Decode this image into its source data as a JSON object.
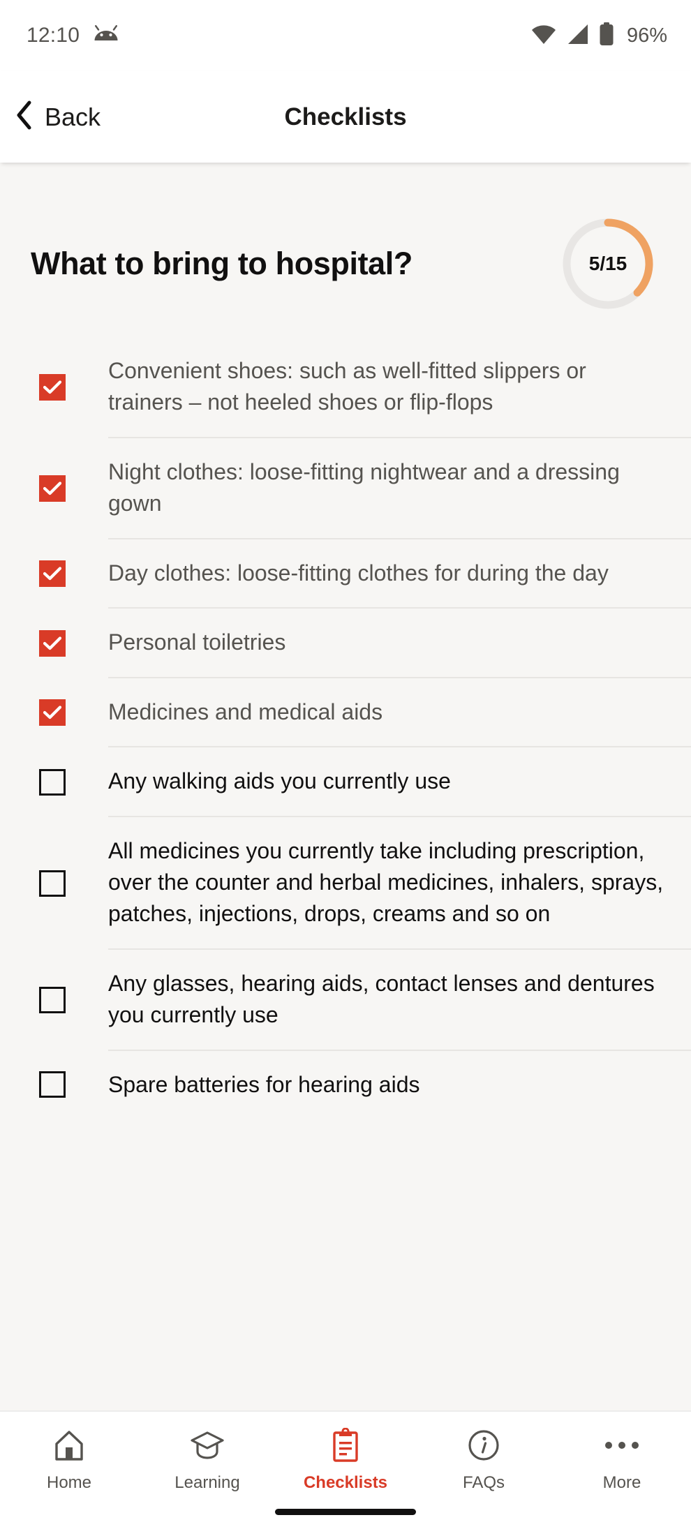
{
  "status_bar": {
    "time": "12:10",
    "battery_percent": "96%",
    "icons": [
      "android-robot-icon",
      "wifi-icon",
      "cellular-signal-icon",
      "battery-icon"
    ]
  },
  "nav_bar": {
    "back_label": "Back",
    "title": "Checklists"
  },
  "page": {
    "title": "What to bring to hospital?",
    "progress": {
      "label": "5/15",
      "completed": 5,
      "total": 15,
      "arc_color": "#efa262",
      "track_color": "#e8e6e4"
    }
  },
  "checklist": {
    "items": [
      {
        "label": "Convenient shoes: such as well-fitted slippers or trainers – not heeled shoes or flip-flops",
        "checked": true
      },
      {
        "label": "Night clothes: loose-fitting nightwear and a dressing gown",
        "checked": true
      },
      {
        "label": "Day clothes: loose-fitting clothes for during the day",
        "checked": true
      },
      {
        "label": "Personal toiletries",
        "checked": true
      },
      {
        "label": "Medicines and medical aids",
        "checked": true
      },
      {
        "label": "Any walking aids you currently use",
        "checked": false
      },
      {
        "label": "All medicines you currently take including prescription, over the counter and herbal medicines, inhalers, sprays, patches, injections, drops, creams and so on",
        "checked": false
      },
      {
        "label": "Any glasses, hearing aids, contact lenses and dentures you currently use",
        "checked": false
      },
      {
        "label": "Spare batteries for hearing aids",
        "checked": false
      }
    ]
  },
  "tab_bar": {
    "tabs": [
      {
        "label": "Home",
        "icon": "home-icon",
        "active": false
      },
      {
        "label": "Learning",
        "icon": "graduation-cap-icon",
        "active": false
      },
      {
        "label": "Checklists",
        "icon": "clipboard-icon",
        "active": true
      },
      {
        "label": "FAQs",
        "icon": "info-circle-icon",
        "active": false
      },
      {
        "label": "More",
        "icon": "ellipsis-icon",
        "active": false
      }
    ]
  },
  "colors": {
    "accent_red": "#d93b27",
    "background": "#f7f6f4",
    "surface": "#ffffff",
    "text_primary": "#111010",
    "text_muted": "#55534f",
    "divider": "#e7e5e2"
  }
}
